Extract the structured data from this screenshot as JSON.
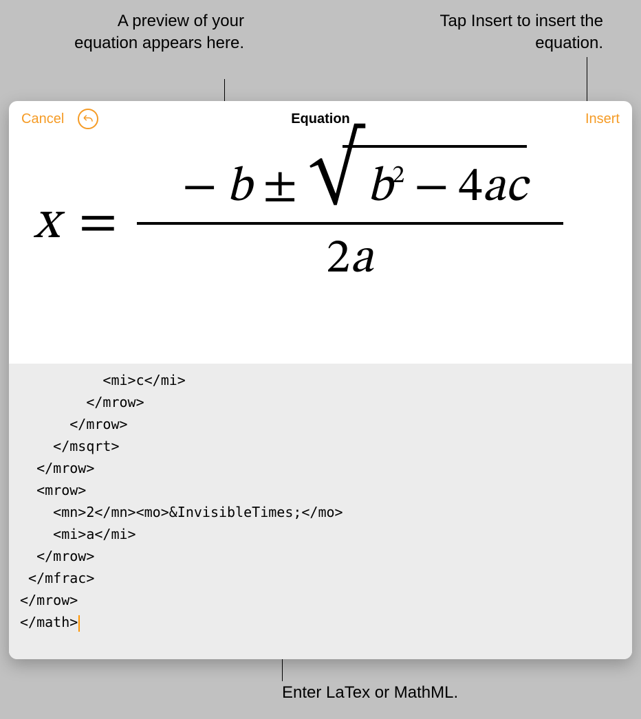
{
  "callouts": {
    "preview": "A preview of your equation appears here.",
    "insert": "Tap Insert to insert the equation.",
    "enter": "Enter LaTex or MathML."
  },
  "navbar": {
    "cancel": "Cancel",
    "title": "Equation",
    "insert": "Insert"
  },
  "code": {
    "text": "          <mi>c</mi>\n        </mrow>\n      </mrow>\n    </msqrt>\n  </mrow>\n  <mrow>\n    <mn>2</mn><mo>&InvisibleTimes;</mo>\n    <mi>a</mi>\n  </mrow>\n </mfrac>\n</mrow>\n</math>"
  },
  "equation": {
    "var_x": "x",
    "eq": "=",
    "minus": "−",
    "var_b": "b",
    "pm": "±",
    "var_b2": "b",
    "sup2": "2",
    "minus2": "−",
    "four": "4",
    "var_a": "a",
    "var_c": "c",
    "two": "2",
    "var_a2": "a"
  }
}
